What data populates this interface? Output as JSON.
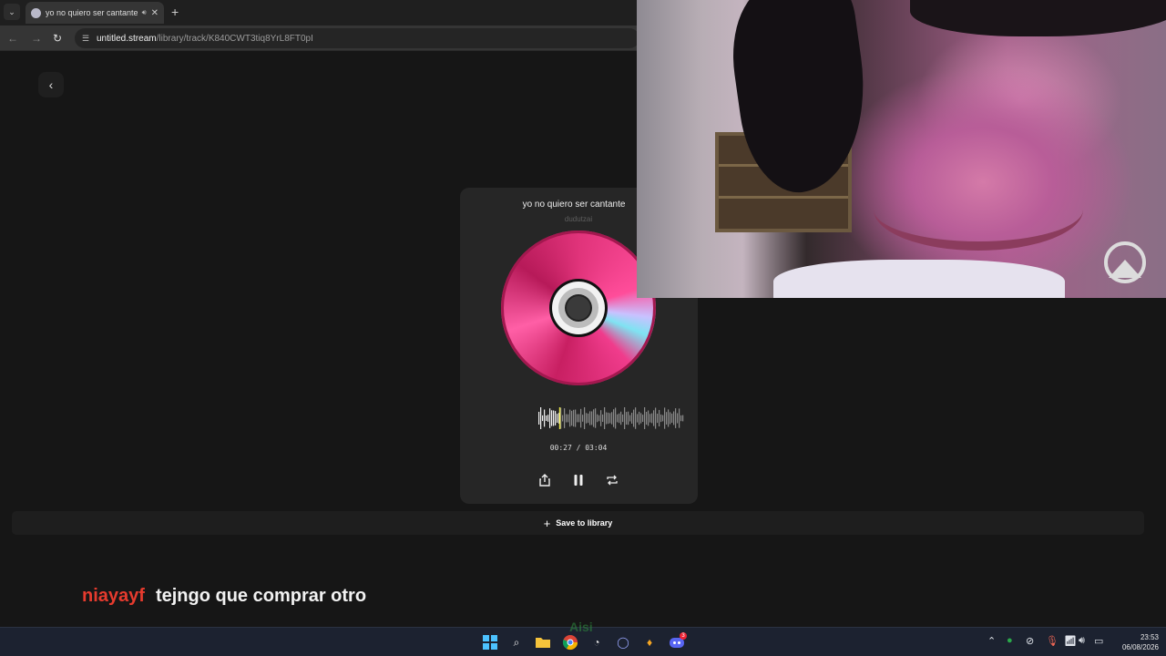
{
  "browser": {
    "tab_title": "yo no quiero ser cantante",
    "new_tab_symbol": "+",
    "url_host": "untitled.stream",
    "url_path": "/library/track/K840CWT3tiq8YrL8FT0pI"
  },
  "player": {
    "track_title": "yo no quiero ser cantante",
    "artist": "dudutzai",
    "time_display": "00:27 / 03:04",
    "progress_fraction": 0.147,
    "save_label": "Save to library"
  },
  "chat": {
    "username": "niayayf",
    "message": "tejngo que comprar otro"
  },
  "taskbar": {
    "watermark": "Aisi",
    "discord_badge": "3",
    "clock_time": "23:53",
    "clock_date": "06/08/2026"
  },
  "colors": {
    "chat_username": "#e63b2e",
    "disc_pink": "#e0337a",
    "accent_playhead": "#e8e34a"
  }
}
